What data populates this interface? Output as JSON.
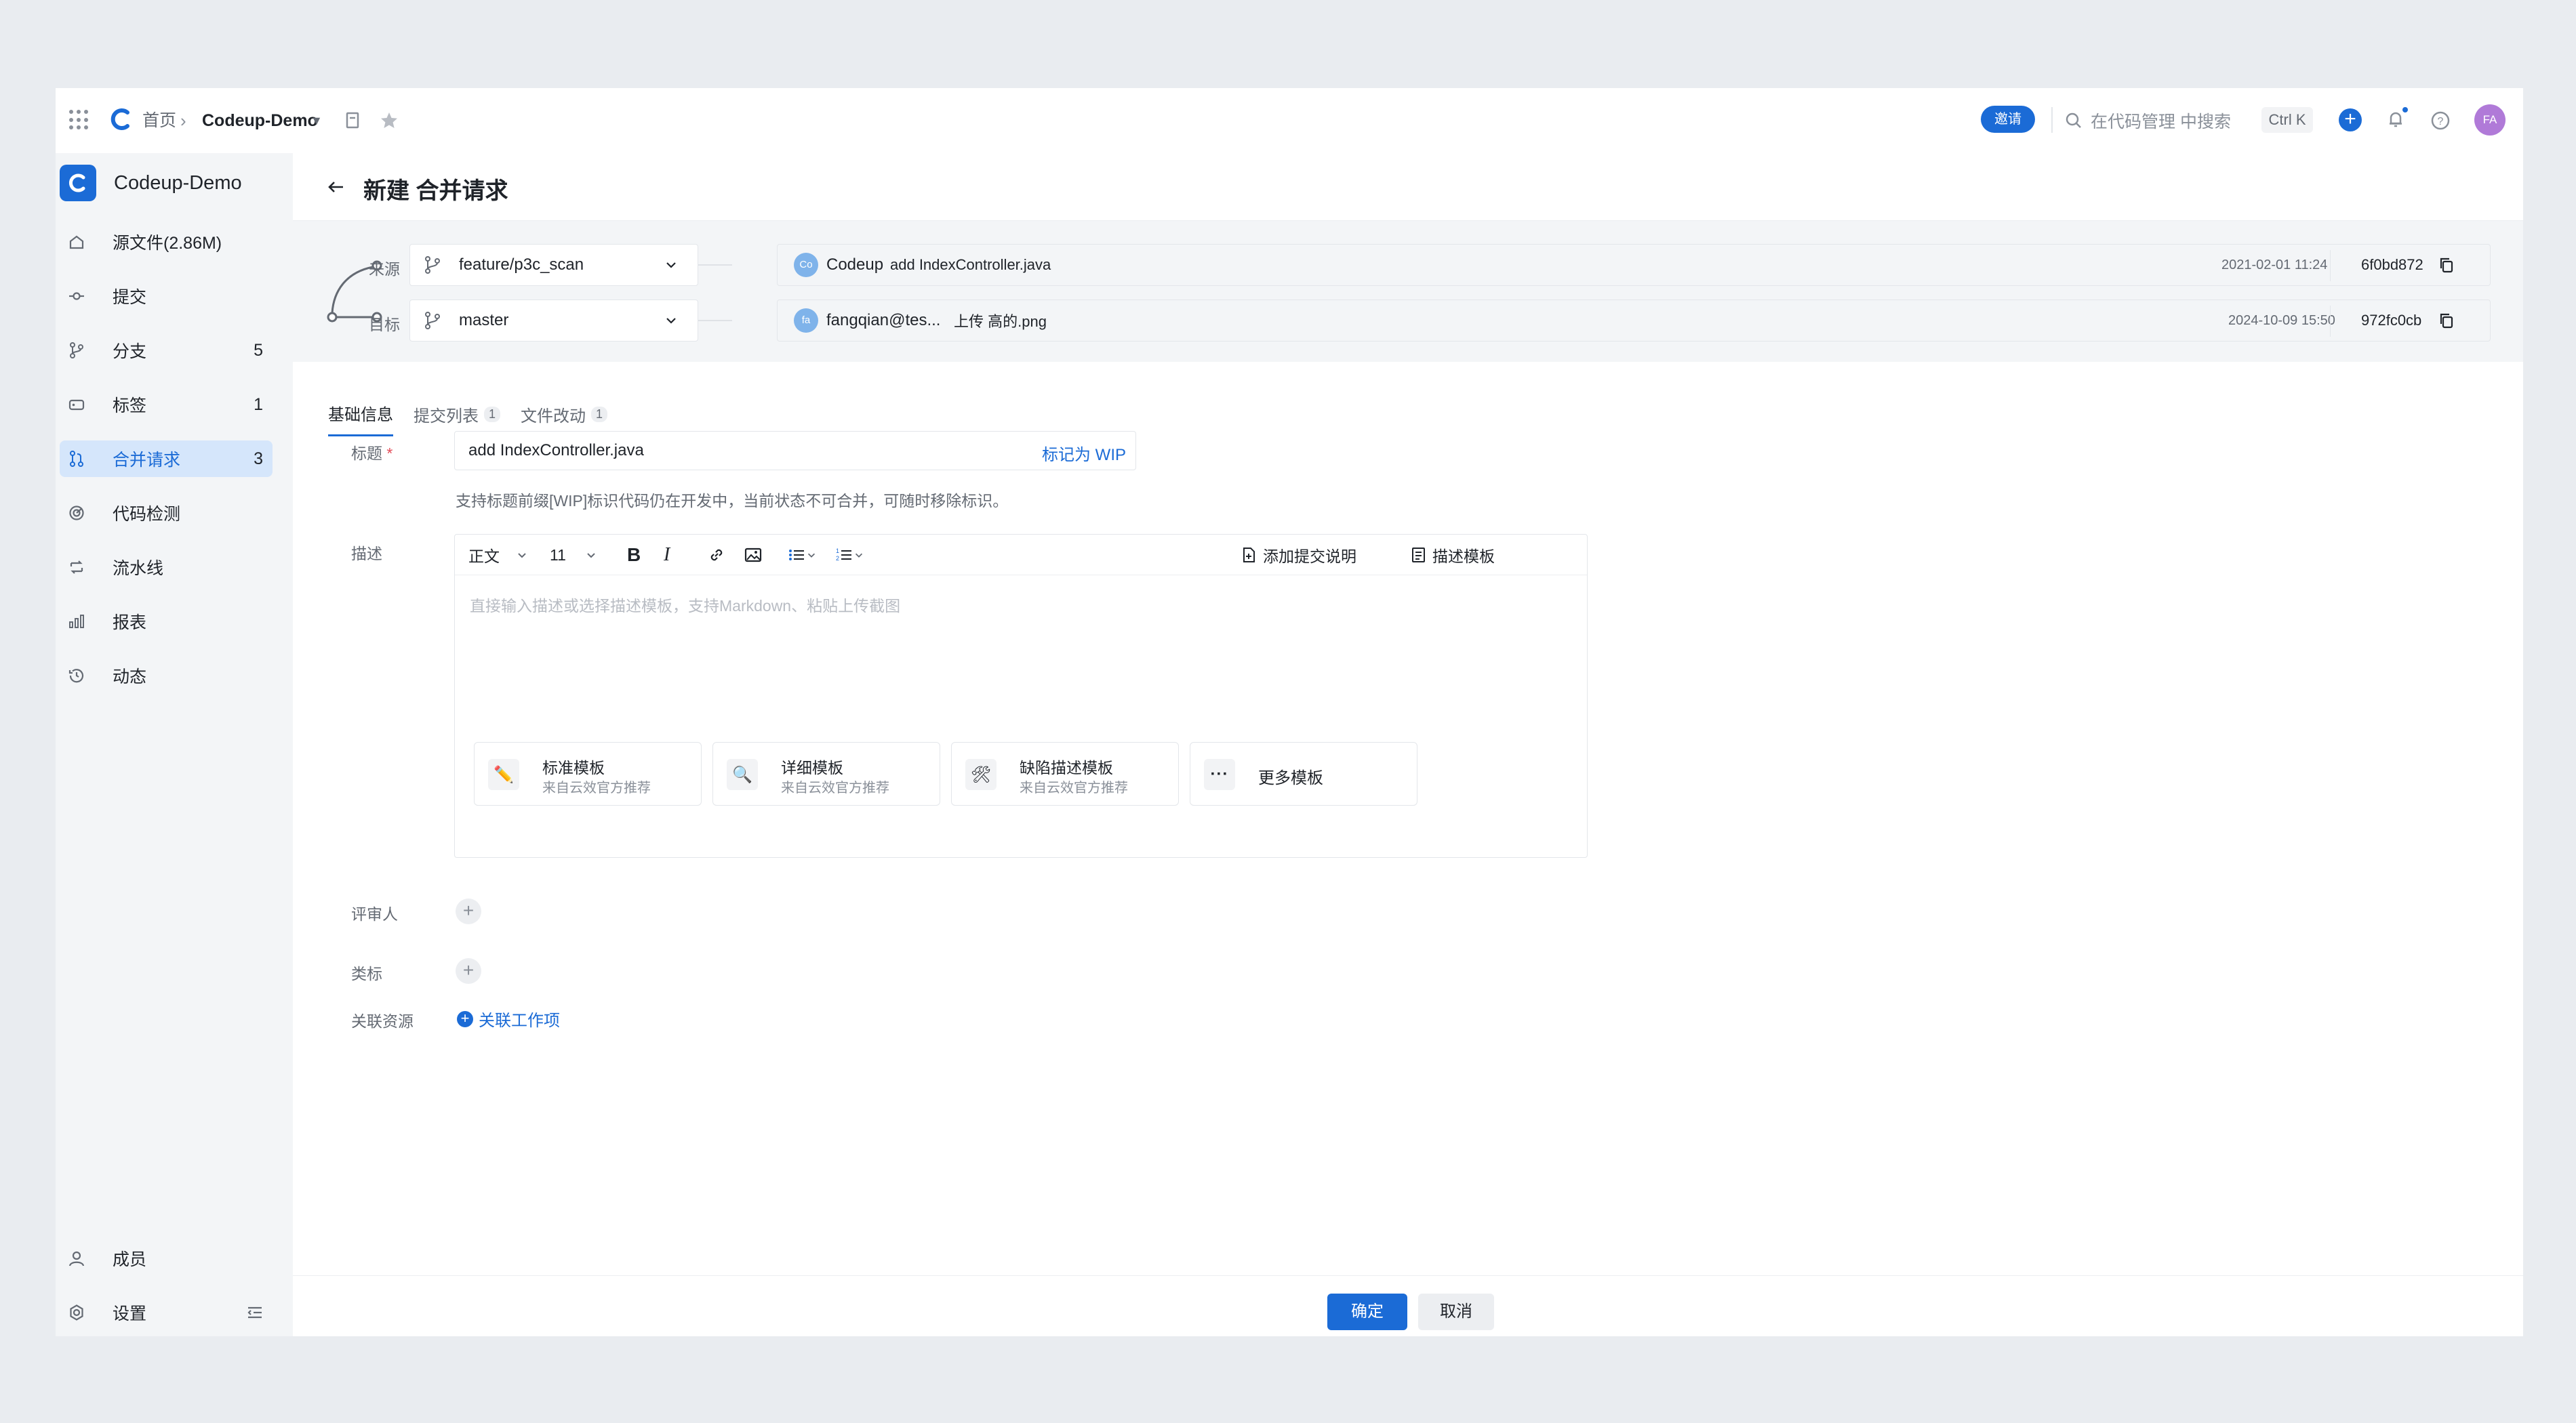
{
  "topbar": {
    "home": "首页",
    "repo": "Codeup-Demo",
    "invite": "邀请",
    "search_placeholder": "在代码管理 中搜索",
    "shortcut": "Ctrl K",
    "avatar": "FA"
  },
  "sidebar": {
    "project_name": "Codeup-Demo",
    "items": [
      {
        "label": "源文件(2.86M)",
        "count": "",
        "icon": "home-icon"
      },
      {
        "label": "提交",
        "count": "",
        "icon": "commit-icon"
      },
      {
        "label": "分支",
        "count": "5",
        "icon": "branch-icon"
      },
      {
        "label": "标签",
        "count": "1",
        "icon": "tag-icon"
      },
      {
        "label": "合并请求",
        "count": "3",
        "icon": "merge-request-icon",
        "active": true
      },
      {
        "label": "代码检测",
        "count": "",
        "icon": "scan-icon"
      },
      {
        "label": "流水线",
        "count": "",
        "icon": "pipeline-icon"
      },
      {
        "label": "报表",
        "count": "",
        "icon": "chart-icon"
      },
      {
        "label": "动态",
        "count": "",
        "icon": "history-icon"
      }
    ],
    "bottom": [
      {
        "label": "成员",
        "icon": "user-icon"
      },
      {
        "label": "设置",
        "icon": "gear-icon"
      }
    ]
  },
  "page": {
    "title": "新建 合并请求"
  },
  "branches": {
    "source_label": "来源",
    "source_branch": "feature/p3c_scan",
    "source_avatar": "Co",
    "source_author": "Codeup",
    "source_message": "add IndexController.java",
    "source_date": "2021-02-01 11:24",
    "source_sha": "6f0bd872",
    "target_label": "目标",
    "target_branch": "master",
    "target_avatar": "fa",
    "target_author": "fangqian@tes...",
    "target_message": "上传 高的.png",
    "target_date": "2024-10-09 15:50",
    "target_sha": "972fc0cb"
  },
  "tabs": [
    {
      "label": "基础信息",
      "count": "",
      "active": true
    },
    {
      "label": "提交列表",
      "count": "1"
    },
    {
      "label": "文件改动",
      "count": "1"
    }
  ],
  "form": {
    "title_label": "标题",
    "title_required": "*",
    "title_value": "add IndexController.java",
    "wip_label": "标记为 WIP",
    "hint": "支持标题前缀[WIP]标识代码仍在开发中，当前状态不可合并，可随时移除标识。",
    "desc_label": "描述",
    "toolbar": {
      "style": "正文",
      "size": "11",
      "add_commit_desc": "添加提交说明",
      "desc_template": "描述模板"
    },
    "desc_placeholder": "直接输入描述或选择描述模板，支持Markdown、粘贴上传截图",
    "templates": [
      {
        "name": "标准模板",
        "sub": "来自云效官方推荐",
        "icon": "pencil-icon"
      },
      {
        "name": "详细模板",
        "sub": "来自云效官方推荐",
        "icon": "magnifier-icon"
      },
      {
        "name": "缺陷描述模板",
        "sub": "来自云效官方推荐",
        "icon": "tools-icon"
      },
      {
        "name": "更多模板",
        "sub": "",
        "icon": "more-icon"
      }
    ],
    "reviewer_label": "评审人",
    "tag_label": "类标",
    "related_label": "关联资源",
    "related_link": "关联工作项"
  },
  "footer": {
    "ok": "确定",
    "cancel": "取消"
  },
  "colors": {
    "accent": "#1b6bd6",
    "sidebar_bg": "#f3f5f7",
    "active_bg": "#d5e6fb"
  }
}
